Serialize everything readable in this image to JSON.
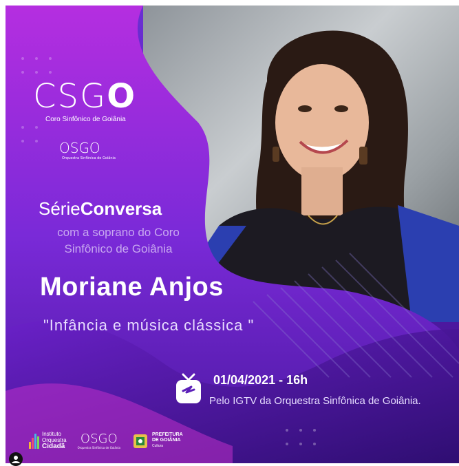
{
  "post": {
    "logo": {
      "mark_light": "CSG",
      "mark_bold": "O",
      "subtitle": "Coro Sinfônico de Goiânia"
    },
    "osgo_small": {
      "mark": "OSGO",
      "subtitle": "Orquestra Sinfônica de Goiânia"
    },
    "serie": {
      "prefix": "Série",
      "bold": "Conversa"
    },
    "subtitle_line1": "com a soprano do Coro",
    "subtitle_line2": "Sinfônico de Goiânia",
    "name": "Moriane Anjos",
    "quote": "\"Infância e música clássica \"",
    "date": "01/04/2021 - 16h",
    "via": "Pelo IGTV da Orquestra Sinfônica de Goiânia.",
    "footer": {
      "instituto_line1": "Instituto",
      "instituto_line2": "Orquestra",
      "instituto_line3": "Cidadã",
      "osgo_mark": "OSGO",
      "osgo_sub": "Orquestra Sinfônica de Goiânia",
      "pref_line1": "PREFEITURA",
      "pref_line2": "DE GOIÂNIA",
      "pref_line3": "Cultura"
    },
    "colors": {
      "purple_main": "#6b2fd4",
      "purple_deep": "#3a1080",
      "magenta": "#c02ee0"
    }
  },
  "icons": [
    "igtv-icon",
    "user-avatar-icon",
    "crest-icon"
  ]
}
